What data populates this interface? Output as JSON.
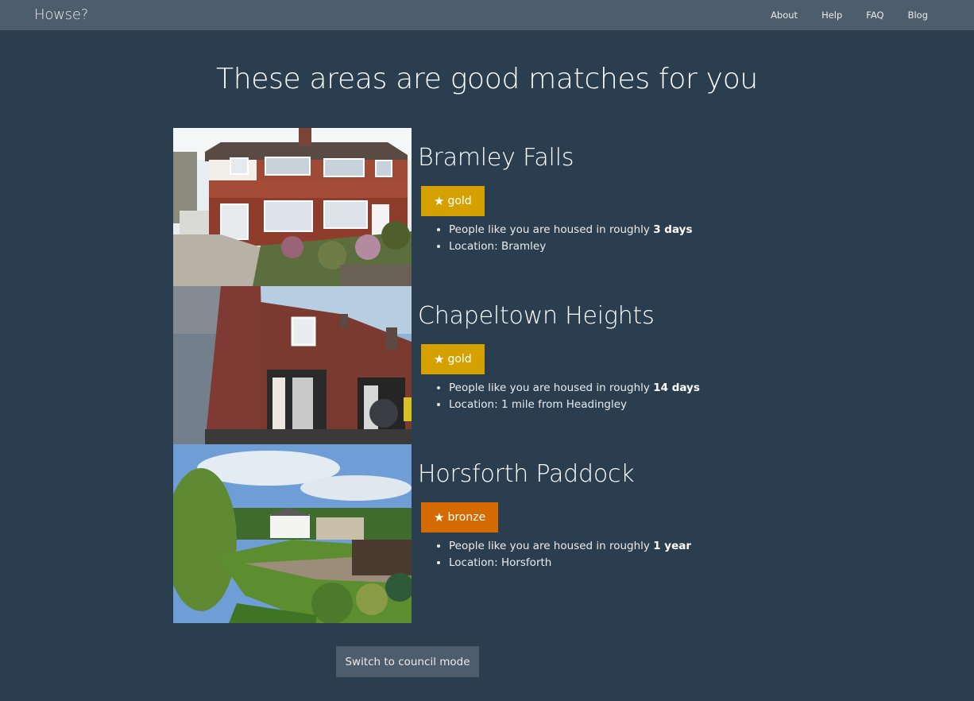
{
  "navbar": {
    "brand": "Howse?",
    "links": [
      "About",
      "Help",
      "FAQ",
      "Blog"
    ]
  },
  "page": {
    "title": "These areas are good matches for you"
  },
  "matches": [
    {
      "name": "Bramley Falls",
      "badge": {
        "label": "gold",
        "color": "#d4a100"
      },
      "housed_prefix": "People like you are housed in roughly",
      "housed_time": "3 days",
      "location": "Location: Bramley"
    },
    {
      "name": "Chapeltown Heights",
      "badge": {
        "label": "gold",
        "color": "#d4a100"
      },
      "housed_prefix": "People like you are housed in roughly",
      "housed_time": "14 days",
      "location": "Location: 1 mile from Headingley"
    },
    {
      "name": "Horsforth Paddock",
      "badge": {
        "label": "bronze",
        "color": "#d46a00"
      },
      "housed_prefix": "People like you are housed in roughly",
      "housed_time": "1 year",
      "location": "Location: Horsforth"
    }
  ],
  "buttons": {
    "council_mode": "Switch to council mode"
  },
  "colors": {
    "background": "#2b3e50",
    "navbar": "#4e5d6c",
    "gold": "#d4a100",
    "bronze": "#d46a00"
  }
}
